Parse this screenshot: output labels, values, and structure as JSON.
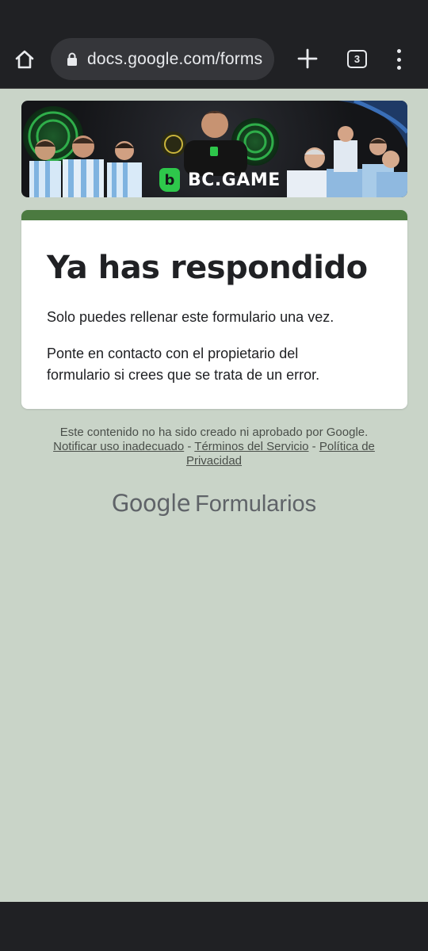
{
  "browser": {
    "url": "docs.google.com/forms",
    "tab_count": "3"
  },
  "banner": {
    "brand_text": "BC.GAME",
    "brand_mark": "b"
  },
  "card": {
    "title": "Ya has respondido",
    "message1": "Solo puedes rellenar este formulario una vez.",
    "message2": "Ponte en contacto con el propietario del formulario si crees que se trata de un error."
  },
  "footer": {
    "disclaimer": "Este contenido no ha sido creado ni aprobado por Google.",
    "link_abuse": "Notificar uso inadecuado",
    "sep1": " - ",
    "link_terms": "Términos del Servicio",
    "sep2": " - ",
    "link_privacy": "Política de Privacidad"
  },
  "brand": {
    "google": "Google",
    "product": "Formularios"
  },
  "colors": {
    "page_bg": "#c9d4c8",
    "accent": "#4b7a40",
    "chrome": "#202124"
  }
}
